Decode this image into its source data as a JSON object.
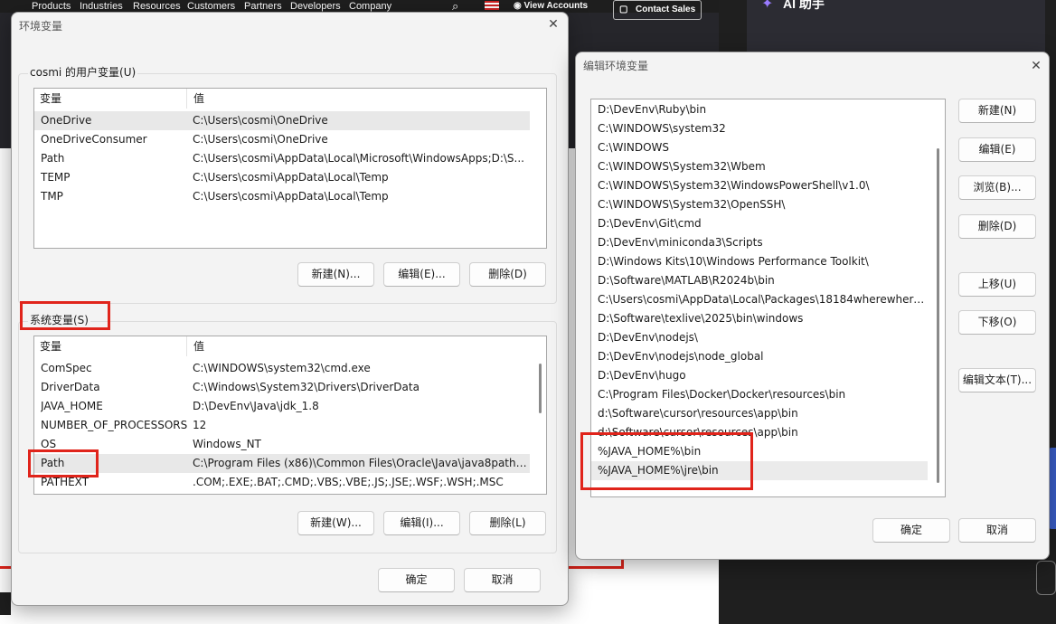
{
  "background": {
    "nav_links": [
      "Products",
      "Industries",
      "Resources",
      "Customers",
      "Partners",
      "Developers",
      "Company"
    ],
    "view_accounts": "View Accounts",
    "contact_sales": "Contact Sales",
    "assistant_label": "AI 助手"
  },
  "env_dialog": {
    "title": "环境变量",
    "user_group_label": "cosmi 的用户变量(U)",
    "col_variable": "变量",
    "col_value": "值",
    "user_vars": [
      {
        "name": "OneDrive",
        "value": "C:\\Users\\cosmi\\OneDrive"
      },
      {
        "name": "OneDriveConsumer",
        "value": "C:\\Users\\cosmi\\OneDrive"
      },
      {
        "name": "Path",
        "value": "C:\\Users\\cosmi\\AppData\\Local\\Microsoft\\WindowsApps;D:\\S..."
      },
      {
        "name": "TEMP",
        "value": "C:\\Users\\cosmi\\AppData\\Local\\Temp"
      },
      {
        "name": "TMP",
        "value": "C:\\Users\\cosmi\\AppData\\Local\\Temp"
      }
    ],
    "user_buttons": {
      "new": "新建(N)...",
      "edit": "编辑(E)...",
      "delete": "删除(D)"
    },
    "system_group_label": "系统变量(S)",
    "system_vars": [
      {
        "name": "ComSpec",
        "value": "C:\\WINDOWS\\system32\\cmd.exe"
      },
      {
        "name": "DriverData",
        "value": "C:\\Windows\\System32\\Drivers\\DriverData"
      },
      {
        "name": "JAVA_HOME",
        "value": "D:\\DevEnv\\Java\\jdk_1.8"
      },
      {
        "name": "NUMBER_OF_PROCESSORS",
        "value": "12"
      },
      {
        "name": "OS",
        "value": "Windows_NT"
      },
      {
        "name": "Path",
        "value": "C:\\Program Files (x86)\\Common Files\\Oracle\\Java\\java8path;..."
      },
      {
        "name": "PATHEXT",
        "value": ".COM;.EXE;.BAT;.CMD;.VBS;.VBE;.JS;.JSE;.WSF;.WSH;.MSC"
      }
    ],
    "system_buttons": {
      "new": "新建(W)...",
      "edit": "编辑(I)...",
      "delete": "删除(L)"
    },
    "ok": "确定",
    "cancel": "取消"
  },
  "edit_dialog": {
    "title": "编辑环境变量",
    "paths": [
      "D:\\DevEnv\\Ruby\\bin",
      "C:\\WINDOWS\\system32",
      "C:\\WINDOWS",
      "C:\\WINDOWS\\System32\\Wbem",
      "C:\\WINDOWS\\System32\\WindowsPowerShell\\v1.0\\",
      "C:\\WINDOWS\\System32\\OpenSSH\\",
      "D:\\DevEnv\\Git\\cmd",
      "D:\\DevEnv\\miniconda3\\Scripts",
      "D:\\Windows Kits\\10\\Windows Performance Toolkit\\",
      "D:\\Software\\MATLAB\\R2024b\\bin",
      "C:\\Users\\cosmi\\AppData\\Local\\Packages\\18184wherewhere....",
      "D:\\Software\\texlive\\2025\\bin\\windows",
      "D:\\DevEnv\\nodejs\\",
      "D:\\DevEnv\\nodejs\\node_global",
      "D:\\DevEnv\\hugo",
      "C:\\Program Files\\Docker\\Docker\\resources\\bin",
      "d:\\Software\\cursor\\resources\\app\\bin",
      "d:\\Software\\cursor\\resources\\app\\bin",
      "%JAVA_HOME%\\bin",
      "%JAVA_HOME%\\jre\\bin"
    ],
    "buttons": {
      "new": "新建(N)",
      "edit": "编辑(E)",
      "browse": "浏览(B)...",
      "delete": "删除(D)",
      "move_up": "上移(U)",
      "move_down": "下移(O)",
      "edit_text": "编辑文本(T)..."
    },
    "ok": "确定",
    "cancel": "取消"
  }
}
